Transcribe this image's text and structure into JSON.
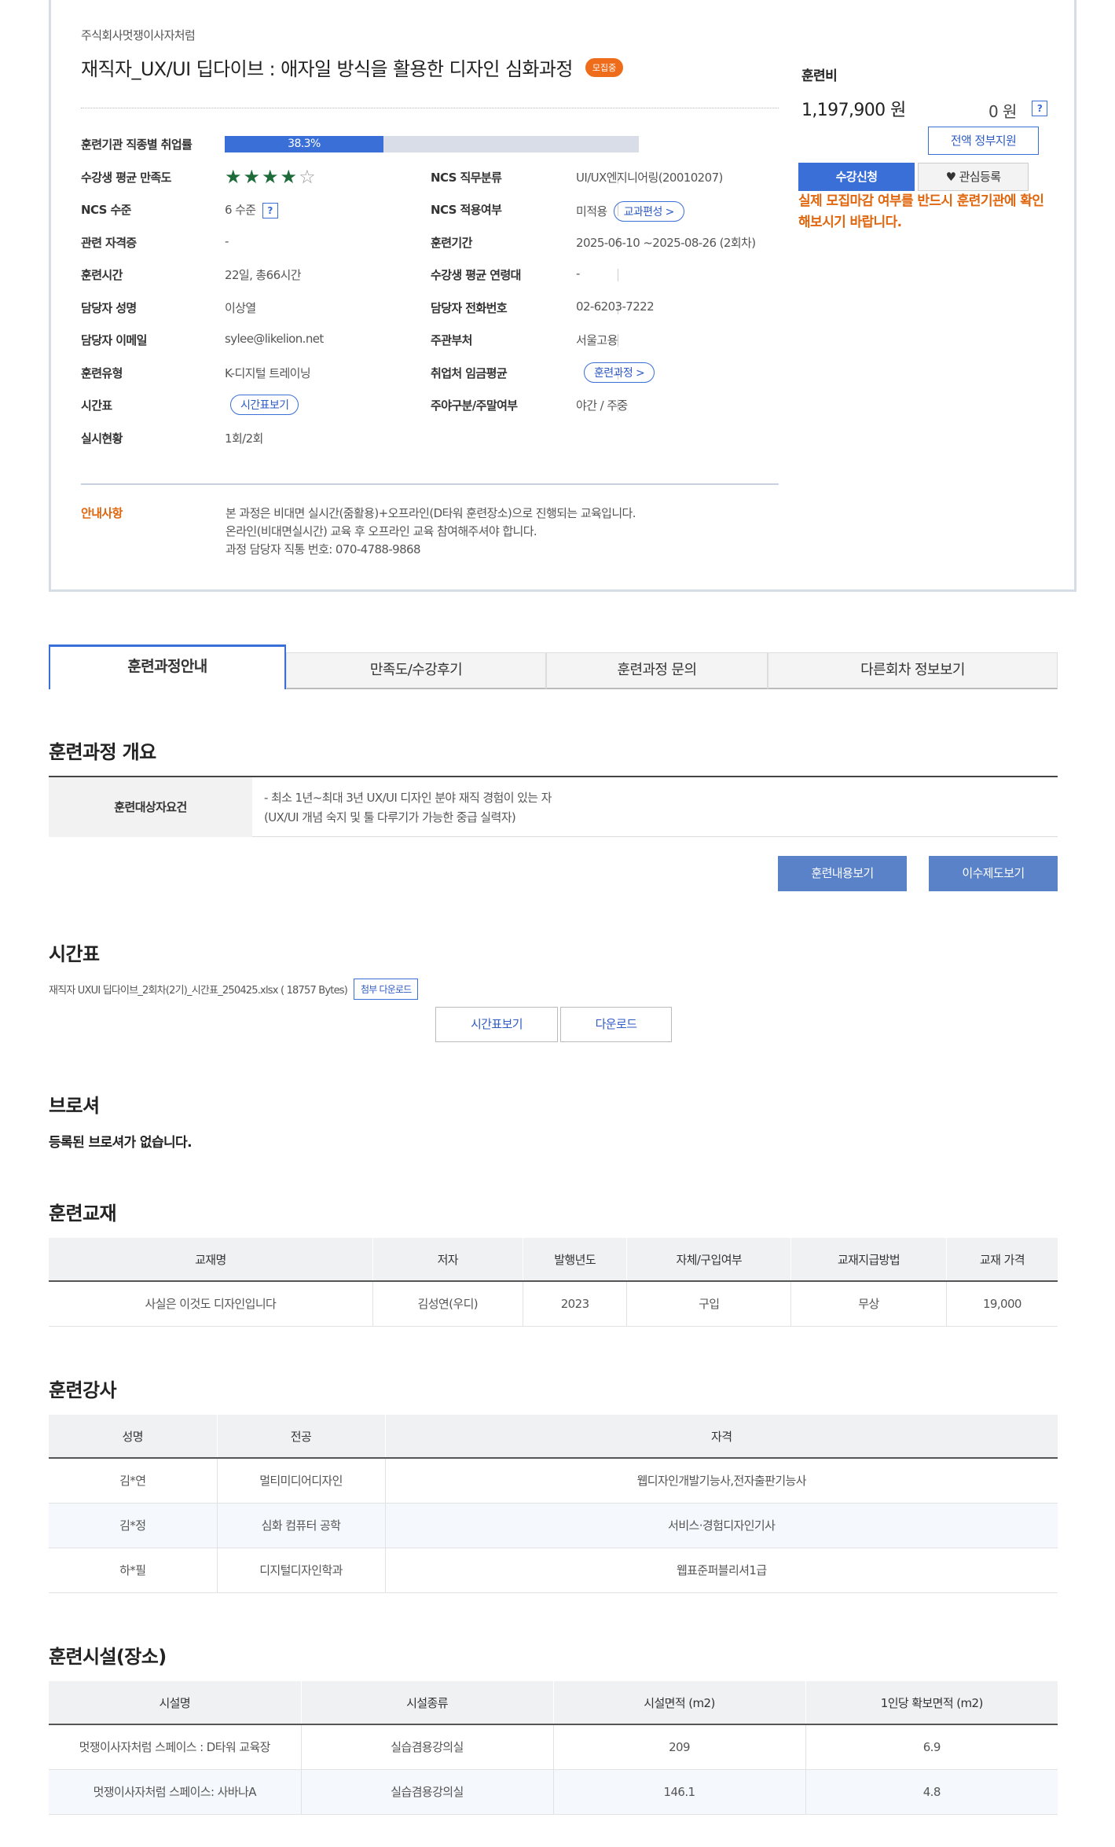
{
  "course": {
    "org": "주식회사멋쟁이사자처럼",
    "title": "재직자_UX/UI 딥다이브 : 애자일 방식을 활용한 디자인 심화과정",
    "badge": "모집중"
  },
  "info": {
    "employment_label": "훈련기관 직종별 취업률",
    "employment_rate_text": "38.3%",
    "employment_rate": 38.3,
    "satisfaction_label": "수강생 평균 만족도",
    "satisfaction_stars": 4,
    "satisfaction_max": 5,
    "ncs_job_label": "NCS 직무분류",
    "ncs_job_value": "UI/UX엔지니어링(20010207)",
    "ncs_level_label": "NCS 수준",
    "ncs_level_value": "6 수준",
    "ncs_apply_label": "NCS 적용여부",
    "ncs_apply_value": "미적용",
    "curriculum_button": "교과편성 >",
    "cert_label": "관련 자격증",
    "cert_value": "-",
    "period_label": "훈련기간",
    "period_value": "2025-06-10 ~2025-08-26 (2회차)",
    "hours_label": "훈련시간",
    "hours_value": "22일, 총66시간",
    "age_label": "수강생 평균 연령대",
    "age_value": "-",
    "manager_label": "담당자 성명",
    "manager_value": "이상열",
    "phone_label": "담당자 전화번호",
    "phone_value": "02-6203-7222",
    "email_label": "담당자 이메일",
    "email_value": "sylee@likelion.net",
    "dept_label": "주관부처",
    "dept_value": "서울고용",
    "type_label": "훈련유형",
    "type_value": "K-디지털 트레이닝",
    "wage_label": "취업처 임금평균",
    "wage_button": "훈련과정 >",
    "schedule_label": "시간표",
    "schedule_button": "시간표보기",
    "daynight_label": "주야구분/주말여부",
    "daynight_value": "야간 / 주중",
    "status_label": "실시현황",
    "status_value": "1회/2회",
    "notice_label": "안내사항",
    "notice_lines": [
      "본 과정은 비대면 실시간(줌활용)+오프라인(D타워 훈련장소)으로 진행되는 교육입니다.",
      "온라인(비대면실시간) 교육 후 오프라인 교육 참여해주셔야 합니다.",
      "과정 담당자 직통 번호: 070-4788-9868"
    ]
  },
  "fee": {
    "label": "훈련비",
    "amount": "1,197,900 원",
    "self_pay": "0 원",
    "gov_button": "전액 정부지원",
    "apply_button": "수강신청",
    "fav_button": "관심등록",
    "warning": "실제 모집마감 여부를 반드시 훈련기관에 확인해보시기 바랍니다."
  },
  "tabs": [
    "훈련과정안내",
    "만족도/수강후기",
    "훈련과정 문의",
    "다른회차 정보보기"
  ],
  "overview": {
    "heading": "훈련과정 개요",
    "req_label": "훈련대상자요건",
    "req_lines": [
      "- 최소 1년~최대 3년 UX/UI 디자인 분야 재직 경험이 있는 자",
      "(UX/UI 개념 숙지 및 툴 다루기가 가능한 중급 실력자)"
    ],
    "content_button": "훈련내용보기",
    "completion_button": "이수제도보기"
  },
  "timetable": {
    "heading": "시간표",
    "file": "재직자 UXUI 딥다이브_2회차(2기)_시간표_250425.xlsx ( 18757 Bytes)",
    "attach_button": "첨부 다운로드",
    "view_button": "시간표보기",
    "download_button": "다운로드"
  },
  "brochure": {
    "heading": "브로셔",
    "empty": "등록된 브로셔가 없습니다."
  },
  "textbook": {
    "heading": "훈련교재",
    "columns": [
      "교재명",
      "저자",
      "발행년도",
      "자체/구입여부",
      "교재지급방법",
      "교재 가격"
    ],
    "rows": [
      [
        "사실은 이것도 디자인입니다",
        "김성연(우디)",
        "2023",
        "구입",
        "무상",
        "19,000"
      ]
    ]
  },
  "instructors": {
    "heading": "훈련강사",
    "columns": [
      "성명",
      "전공",
      "자격"
    ],
    "rows": [
      [
        "김*연",
        "멀티미디어디자인",
        "웹디자인개발기능사,전자출판기능사"
      ],
      [
        "김*정",
        "심화 컴퓨터 공학",
        "서비스·경험디자인기사"
      ],
      [
        "하*필",
        "디지털디자인학과",
        "웹표준퍼블리셔1급"
      ]
    ]
  },
  "facilities": {
    "heading": "훈련시설(장소)",
    "columns": [
      "시설명",
      "시설종류",
      "시설면적 (m2)",
      "1인당 확보면적 (m2)"
    ],
    "rows": [
      [
        "멋쟁이사자처럼 스페이스 : D타워 교육장",
        "실습겸용강의실",
        "209",
        "6.9"
      ],
      [
        "멋쟁이사자처럼 스페이스: 사바나A",
        "실습겸용강의실",
        "146.1",
        "4.8"
      ]
    ]
  }
}
